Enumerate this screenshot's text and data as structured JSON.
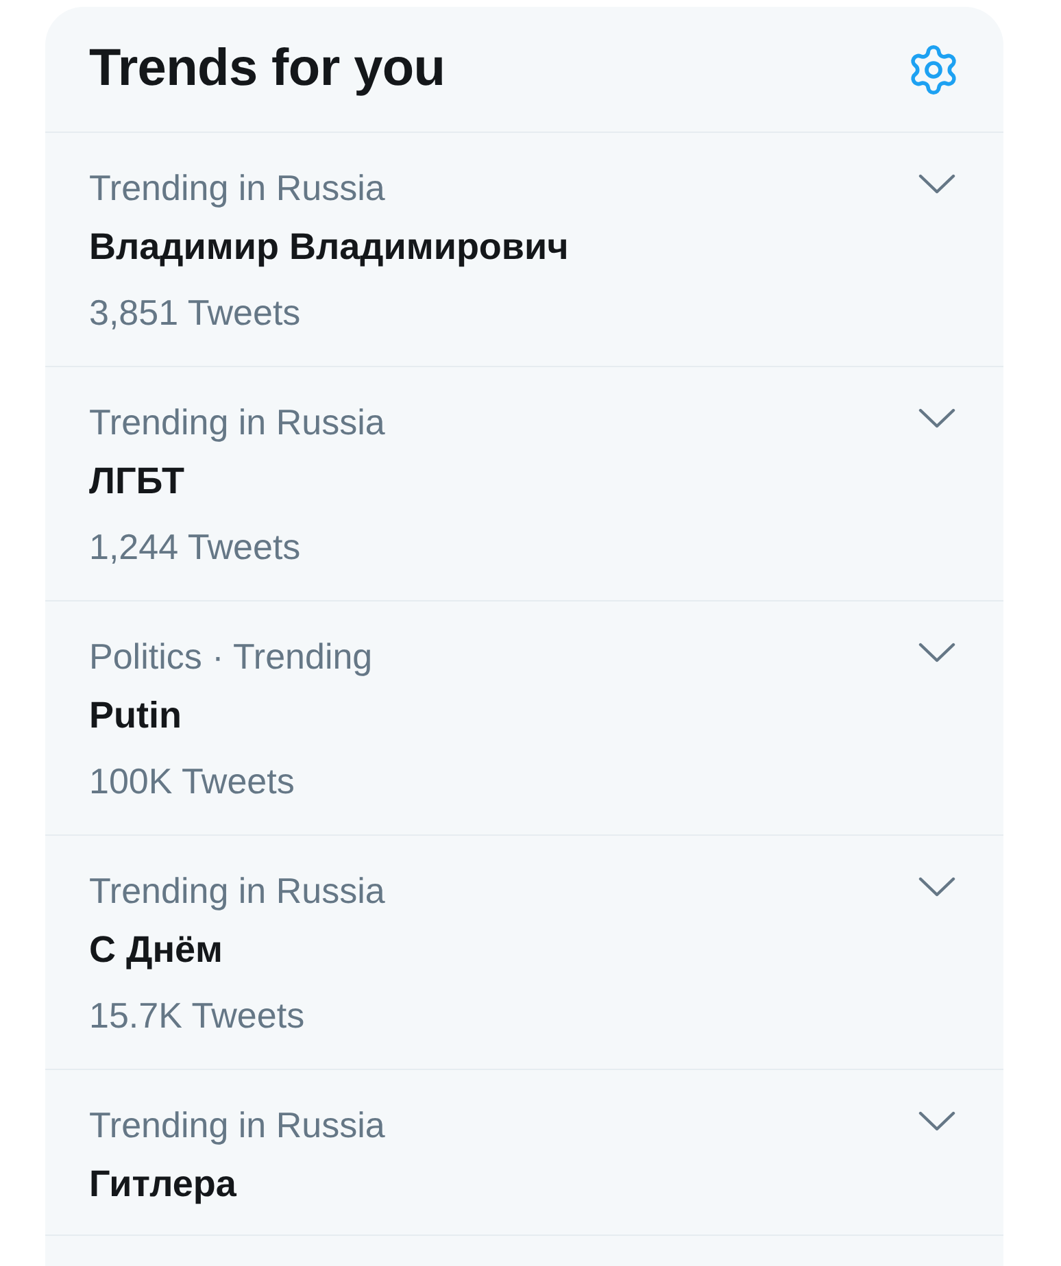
{
  "header": {
    "title": "Trends for you"
  },
  "trends": [
    {
      "context": "Trending in Russia",
      "name": "Владимир Владимирович",
      "count": "3,851 Tweets"
    },
    {
      "context": "Trending in Russia",
      "name": "ЛГБТ",
      "count": "1,244 Tweets"
    },
    {
      "context": "Politics · Trending",
      "name": "Putin",
      "count": "100K Tweets"
    },
    {
      "context": "Trending in Russia",
      "name": "С Днём",
      "count": "15.7K Tweets"
    },
    {
      "context": "Trending in Russia",
      "name": "Гитлера"
    }
  ]
}
